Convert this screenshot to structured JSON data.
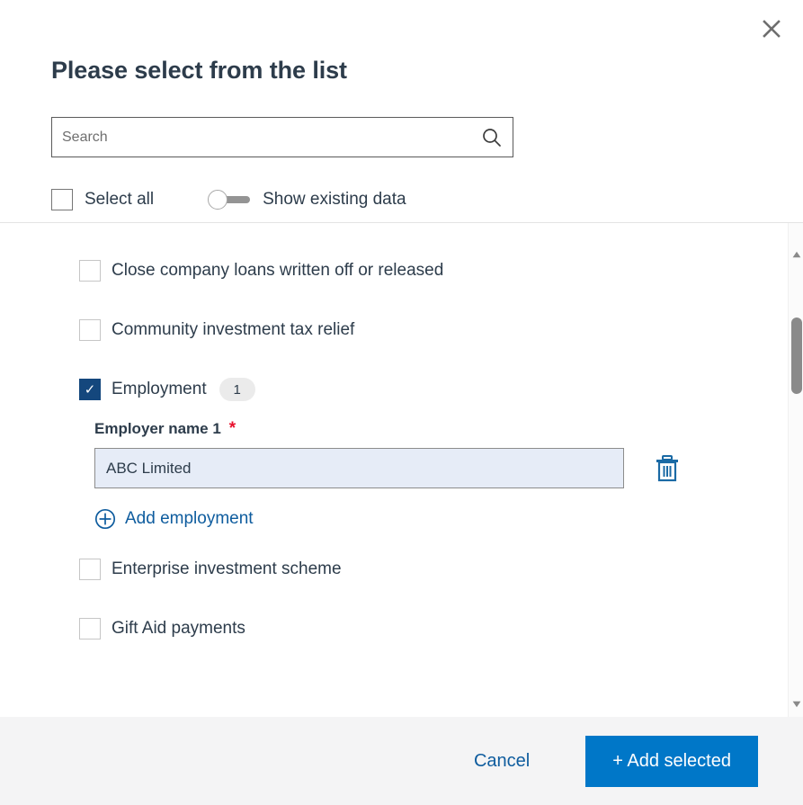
{
  "dialog": {
    "title": "Please select from the list",
    "close_icon": "close-icon"
  },
  "search": {
    "placeholder": "Search",
    "value": "",
    "icon": "search-icon"
  },
  "controls": {
    "select_all_label": "Select all",
    "select_all_checked": false,
    "toggle_label": "Show existing data",
    "toggle_on": false
  },
  "list": {
    "items": [
      {
        "label": "Close company loans written off or released",
        "checked": false,
        "badge": null
      },
      {
        "label": "Community investment tax relief",
        "checked": false,
        "badge": null
      },
      {
        "label": "Employment",
        "checked": true,
        "badge": "1"
      },
      {
        "label": "Enterprise investment scheme",
        "checked": false,
        "badge": null
      },
      {
        "label": "Gift Aid payments",
        "checked": false,
        "badge": null
      }
    ]
  },
  "employment_detail": {
    "field_label": "Employer name 1",
    "required_marker": "*",
    "field_value": "ABC Limited",
    "delete_icon": "trash-icon",
    "add_link_label": "Add employment",
    "add_link_icon": "plus-circle-icon"
  },
  "scrollbar": {
    "up_icon": "caret-up-icon",
    "down_icon": "caret-down-icon"
  },
  "footer": {
    "cancel_label": "Cancel",
    "submit_label": "+ Add selected"
  },
  "colors": {
    "primary_blue": "#0077c8",
    "link_blue": "#0e5c9e",
    "checkbox_navy": "#14477d",
    "required_red": "#e8112d",
    "text_dark": "#2d3c4b",
    "footer_bg": "#f4f4f5",
    "input_bg": "#e6ecf7"
  }
}
